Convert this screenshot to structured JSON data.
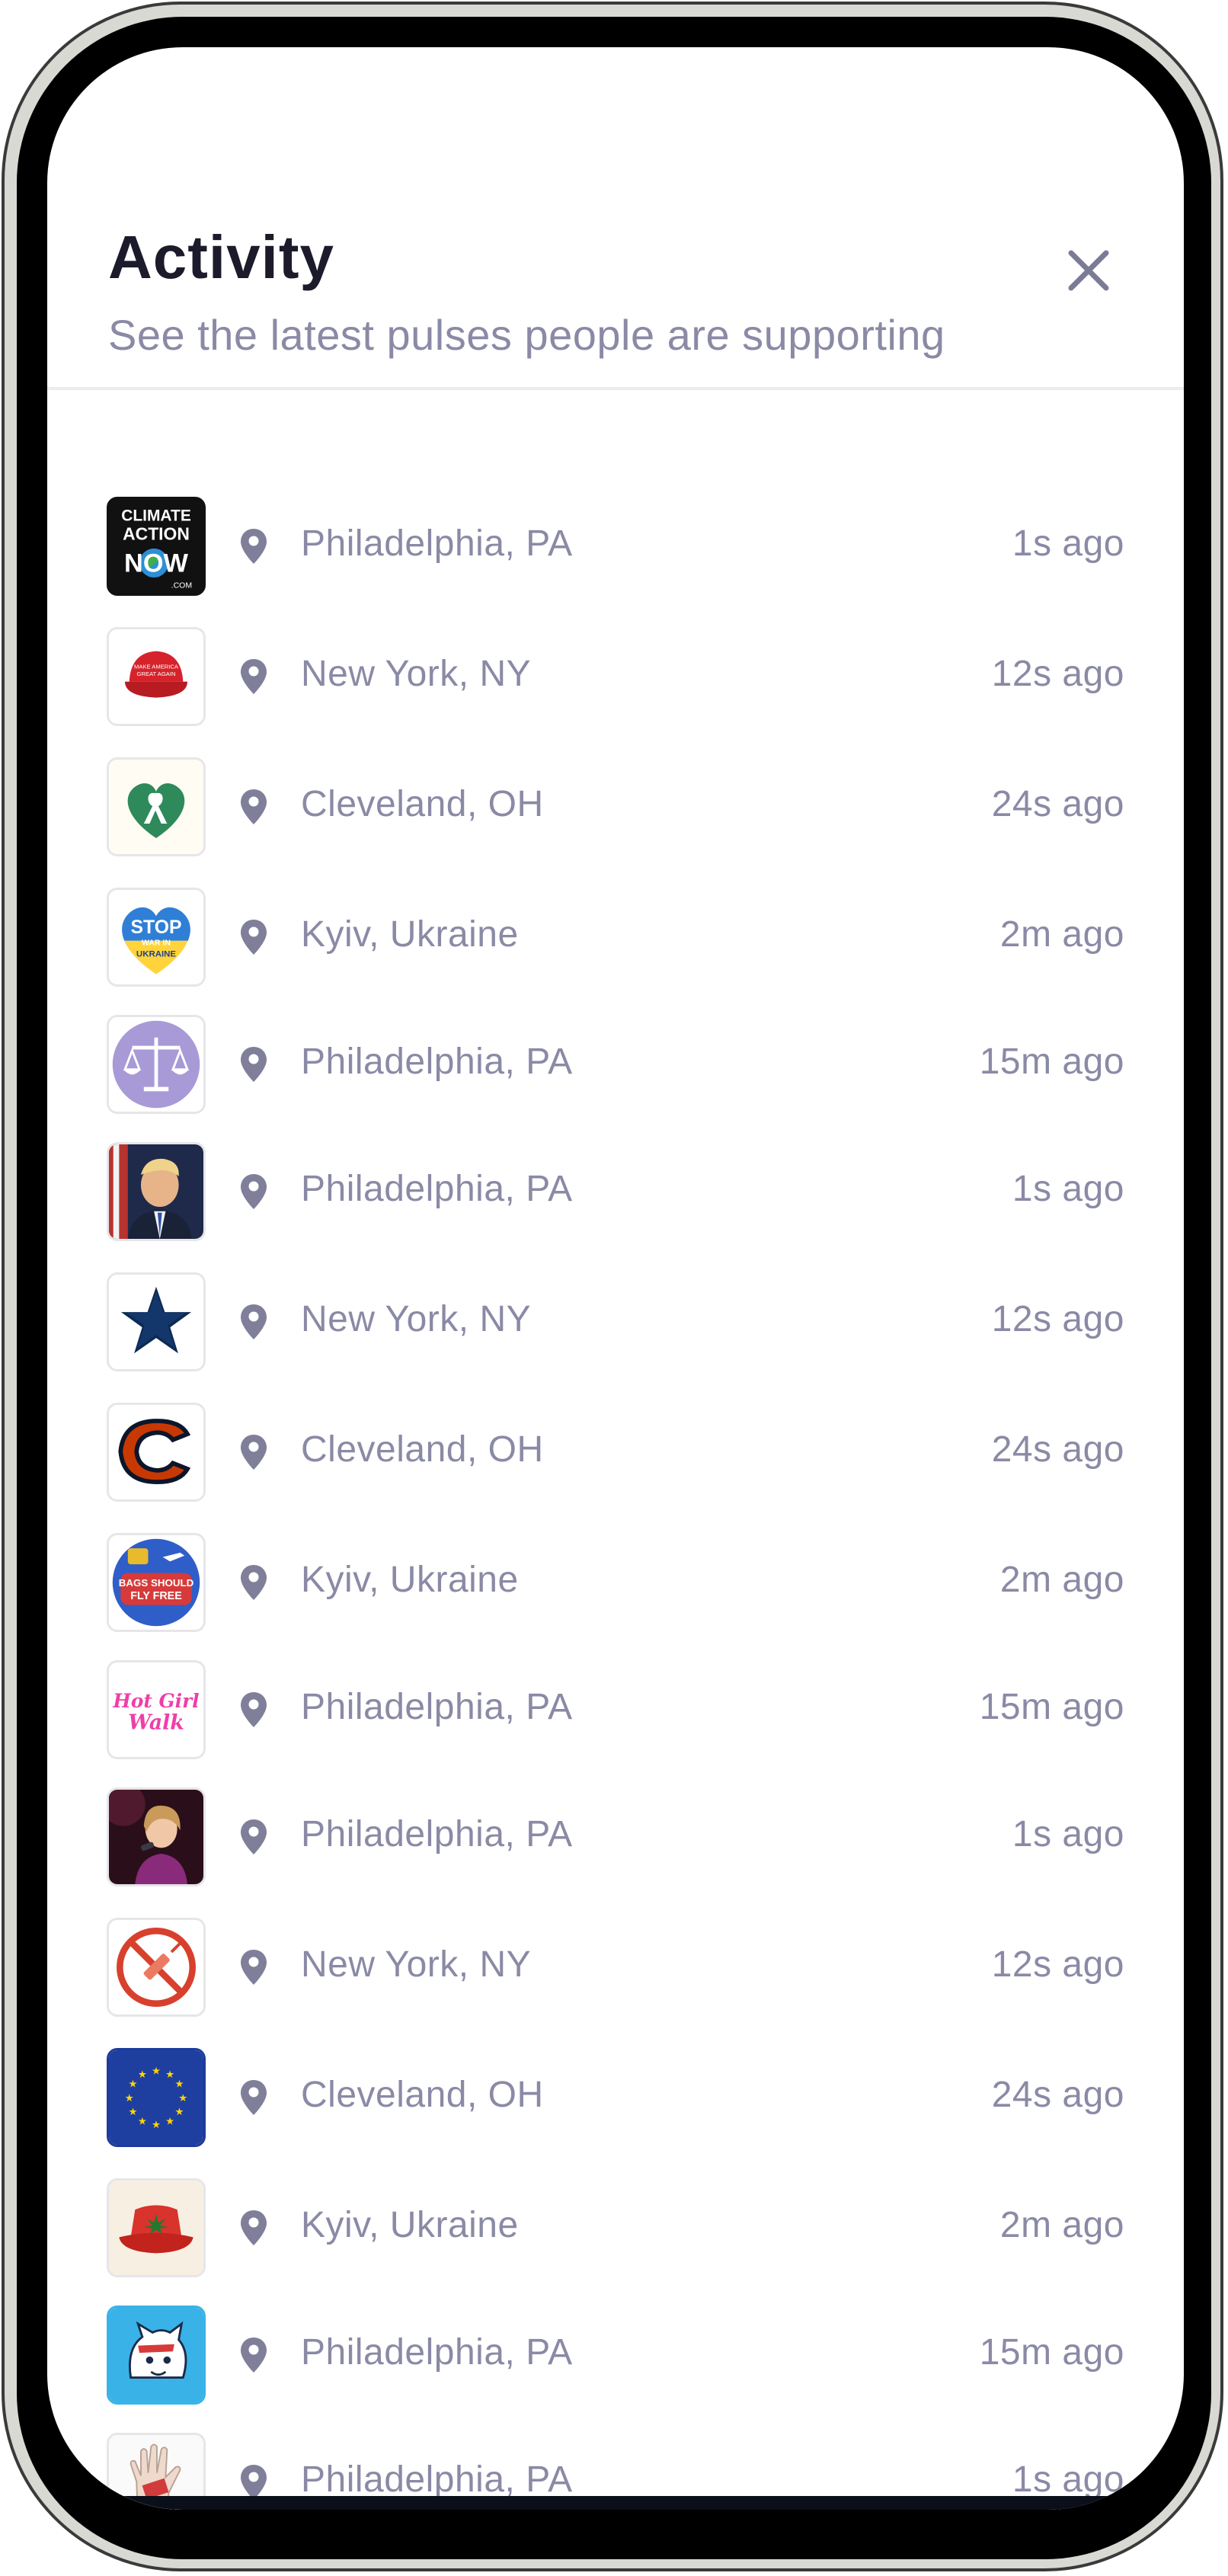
{
  "header": {
    "title": "Activity",
    "subtitle": "See the latest pulses people are supporting",
    "close_icon": "close-icon"
  },
  "colors": {
    "title": "#1c1b2b",
    "muted_text": "#8a8aa6",
    "pin_icon": "#7f7f9a",
    "divider": "#ececf0"
  },
  "activity": [
    {
      "thumb": "climate-action-now-logo",
      "thumb_text": [
        "CLIMATE",
        "ACTION",
        "NOW",
        ".COM"
      ],
      "location": "Philadelphia, PA",
      "time": "1s ago"
    },
    {
      "thumb": "red-cap-image",
      "thumb_text": [
        "MAKE AMERICA",
        "GREAT AGAIN"
      ],
      "location": "New York, NY",
      "time": "12s ago"
    },
    {
      "thumb": "green-heart-ribbon-icon",
      "location": "Cleveland, OH",
      "time": "24s ago"
    },
    {
      "thumb": "stop-war-heart-logo",
      "thumb_text": [
        "STOP",
        "WAR IN",
        "UKRAINE"
      ],
      "location": "Kyiv, Ukraine",
      "time": "2m ago"
    },
    {
      "thumb": "scales-of-justice-icon",
      "location": "Philadelphia, PA",
      "time": "15m ago"
    },
    {
      "thumb": "portrait-photo",
      "location": "Philadelphia, PA",
      "time": "1s ago"
    },
    {
      "thumb": "star-logo",
      "location": "New York, NY",
      "time": "12s ago"
    },
    {
      "thumb": "letter-c-logo",
      "location": "Cleveland, OH",
      "time": "24s ago"
    },
    {
      "thumb": "bags-should-fly-free-badge",
      "thumb_text": [
        "BAGS SHOULD",
        "FLY FREE"
      ],
      "location": "Kyiv, Ukraine",
      "time": "2m ago"
    },
    {
      "thumb": "hot-girl-walk-logo",
      "thumb_text": [
        "Hot Girl",
        "Walk"
      ],
      "location": "Philadelphia, PA",
      "time": "15m ago"
    },
    {
      "thumb": "singer-photo",
      "location": "Philadelphia, PA",
      "time": "1s ago"
    },
    {
      "thumb": "no-syringe-icon",
      "location": "New York, NY",
      "time": "12s ago"
    },
    {
      "thumb": "eu-flag",
      "location": "Cleveland, OH",
      "time": "24s ago"
    },
    {
      "thumb": "red-bucket-hat-image",
      "location": "Kyiv, Ukraine",
      "time": "2m ago"
    },
    {
      "thumb": "tiger-mascot-logo",
      "location": "Philadelphia, PA",
      "time": "15m ago"
    },
    {
      "thumb": "raised-hand-image",
      "location": "Philadelphia, PA",
      "time": "1s ago"
    }
  ]
}
